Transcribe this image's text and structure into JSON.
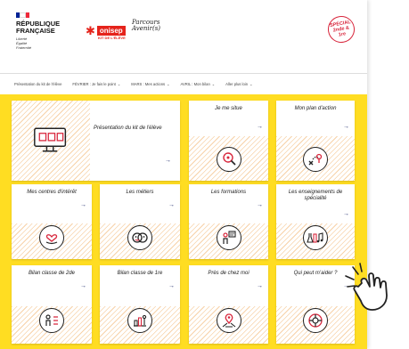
{
  "header": {
    "republique": {
      "line1": "RÉPUBLIQUE",
      "line2": "FRANÇAISE",
      "motto": [
        "Liberté",
        "Égalité",
        "Fraternité"
      ]
    },
    "onisep": {
      "name": "onisep",
      "subtitle": "KIT DE L'ÉLÈVE"
    },
    "avenirs": {
      "line1": "Parcours",
      "line2": "Avenir(s)"
    },
    "stamp": {
      "line1": "SPÉCIAL",
      "line2": "2nde & 1re"
    }
  },
  "nav": [
    {
      "label": "Présentation du kit de l'élève",
      "has_menu": false
    },
    {
      "label": "FÉVRIER : Je fais le point",
      "has_menu": true
    },
    {
      "label": "MARS : Mes actions",
      "has_menu": true
    },
    {
      "label": "AVRIL : Mon bilan",
      "has_menu": true
    },
    {
      "label": "Aller plus loin",
      "has_menu": true
    }
  ],
  "cards": [
    {
      "title": "Présentation du kit de l'élève",
      "icon": "screen-icon"
    },
    {
      "title": "Je me situe",
      "icon": "location-search-icon"
    },
    {
      "title": "Mon plan d'action",
      "icon": "plan-icon"
    },
    {
      "title": "Mes centres d'intérêt",
      "icon": "heart-hand-icon"
    },
    {
      "title": "Les métiers",
      "icon": "masks-icon"
    },
    {
      "title": "Les formations",
      "icon": "teacher-icon"
    },
    {
      "title": "Les enseignements de spécialité",
      "icon": "lab-music-icon"
    },
    {
      "title": "Bilan classe de 2de",
      "icon": "people-list-icon"
    },
    {
      "title": "Bilan classe de 1re",
      "icon": "chart-icon"
    },
    {
      "title": "Près de chez moi",
      "icon": "map-pin-icon"
    },
    {
      "title": "Qui peut m'aider ?",
      "icon": "lifebuoy-icon"
    }
  ],
  "arrow": "→",
  "colors": {
    "board": "#ffdd22",
    "accent": "#e5231b",
    "arrow": "#1d2a6b",
    "hatch": "#f7d2a8"
  }
}
